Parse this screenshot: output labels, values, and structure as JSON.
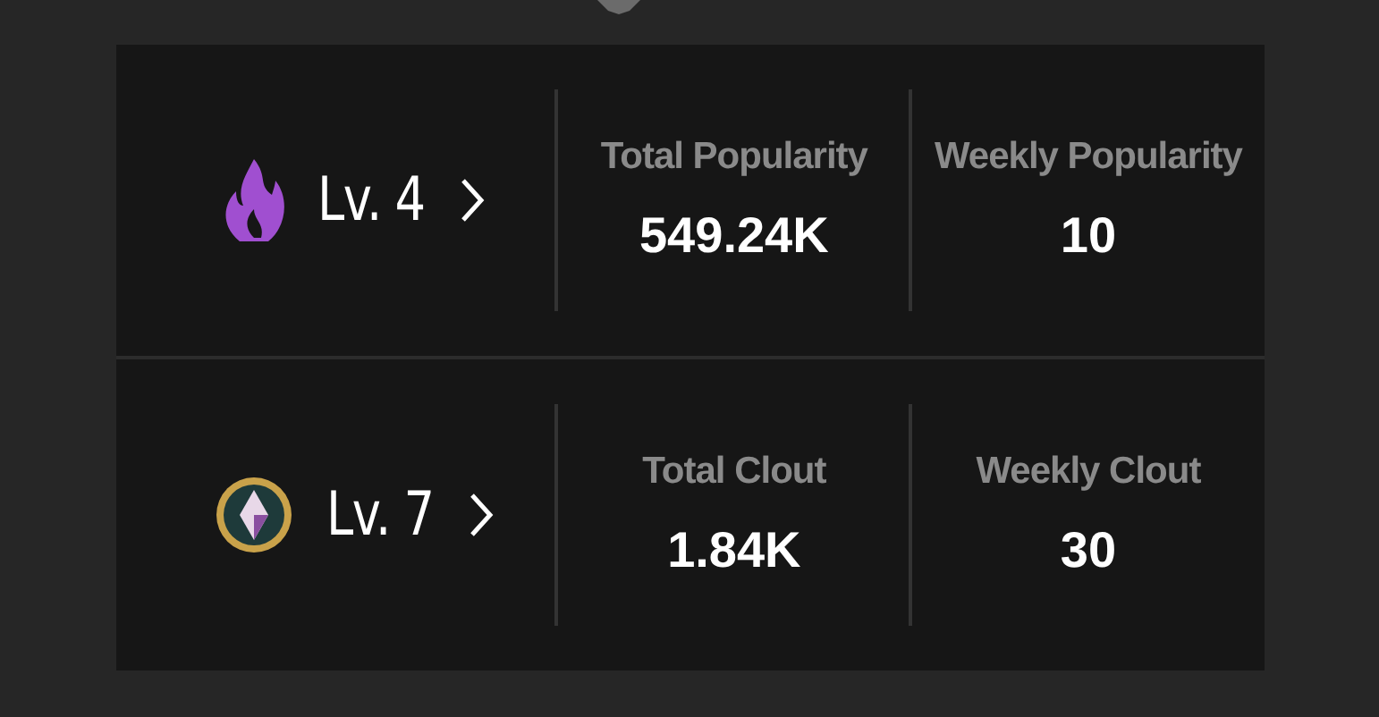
{
  "rows": [
    {
      "kind": "flame",
      "level": "Lv. 4",
      "stats": [
        {
          "label": "Total Popularity",
          "value": "549.24K"
        },
        {
          "label": "Weekly Popularity",
          "value": "10"
        }
      ]
    },
    {
      "kind": "gem",
      "level": "Lv. 7",
      "stats": [
        {
          "label": "Total Clout",
          "value": "1.84K"
        },
        {
          "label": "Weekly Clout",
          "value": "30"
        }
      ]
    }
  ]
}
